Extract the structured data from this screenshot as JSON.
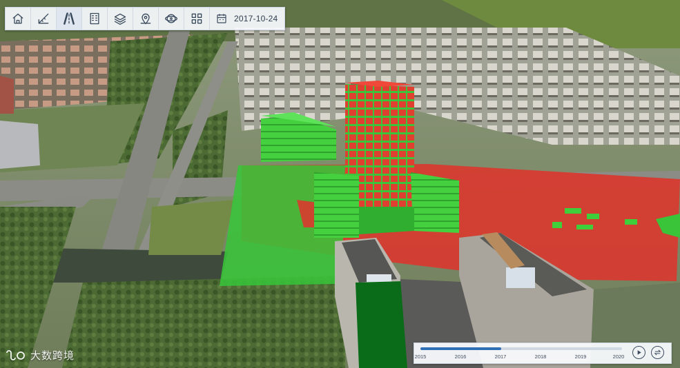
{
  "toolbar": {
    "buttons": [
      {
        "name": "home-button",
        "icon": "home-icon"
      },
      {
        "name": "measure-button",
        "icon": "measure-icon"
      },
      {
        "name": "road-button",
        "icon": "road-icon"
      },
      {
        "name": "building-button",
        "icon": "building-icon"
      },
      {
        "name": "layers-button",
        "icon": "layers-icon"
      },
      {
        "name": "map-location-button",
        "icon": "map-pin-icon"
      },
      {
        "name": "rotate-view-button",
        "icon": "orbit-icon"
      },
      {
        "name": "apps-grid-button",
        "icon": "grid-icon"
      }
    ],
    "date_label": "2017-10-24"
  },
  "timeline": {
    "years": [
      "2015",
      "2016",
      "2017",
      "2018",
      "2019",
      "2020"
    ],
    "progress_fraction": 0.4,
    "play_icon": "play-icon",
    "swap_icon": "swap-icon"
  },
  "logo": {
    "text": "大数跨境",
    "icon": "infinity-logo-icon"
  },
  "scene": {
    "description_tags": [
      "3d-city-model",
      "shadow-analysis-overlay"
    ],
    "colors": {
      "shadow_red": "#d9382f",
      "sunlit_green": "#39c43a",
      "building_red": "#e23b2c",
      "building_green": "#3fcf3a"
    }
  }
}
